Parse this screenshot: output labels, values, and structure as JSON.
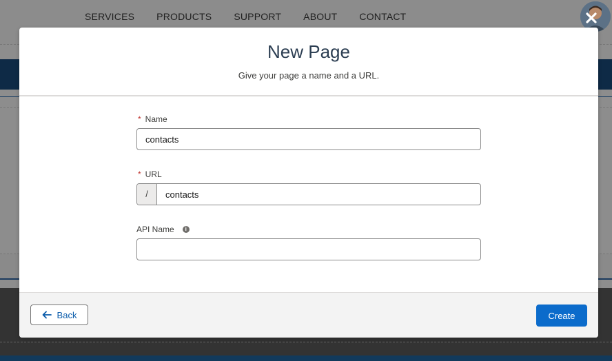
{
  "background": {
    "nav_links": [
      "SERVICES",
      "PRODUCTS",
      "SUPPORT",
      "ABOUT",
      "CONTACT"
    ]
  },
  "modal": {
    "title": "New Page",
    "subtitle": "Give your page a name and a URL.",
    "fields": {
      "name": {
        "label": "Name",
        "required_marker": "*",
        "value": "contacts"
      },
      "url": {
        "label": "URL",
        "required_marker": "*",
        "prefix": "/",
        "value": "contacts"
      },
      "api_name": {
        "label": "API Name",
        "value": ""
      }
    },
    "buttons": {
      "back": "Back",
      "create": "Create"
    },
    "icons": {
      "close": "close-icon",
      "back": "arrow-left-icon",
      "info": "info-icon"
    }
  },
  "colors": {
    "brand": "#0b6bcb",
    "required": "#c23934",
    "title": "#2c3e52"
  }
}
